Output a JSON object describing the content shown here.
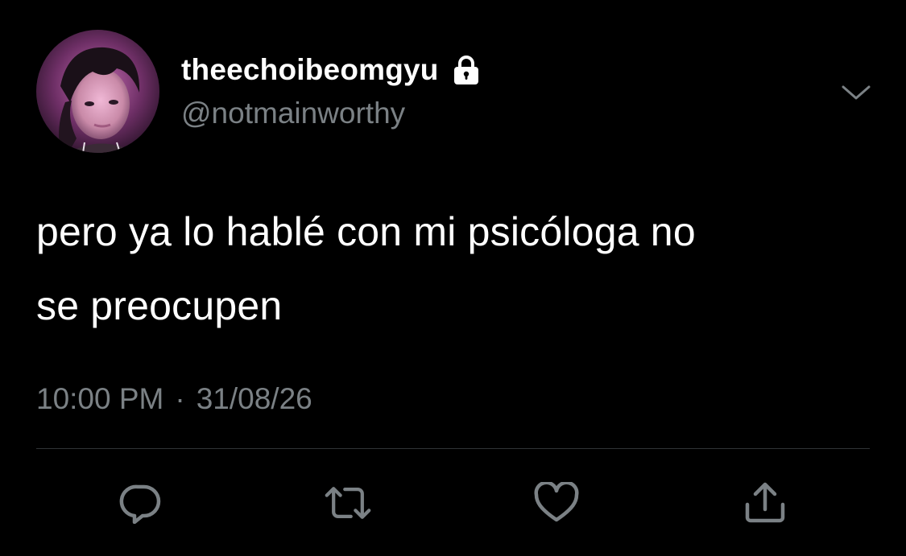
{
  "user": {
    "display_name": "theechoibeomgyu",
    "handle": "@notmainworthy",
    "protected_icon": "lock-icon"
  },
  "tweet": {
    "text_line_1": "pero ya lo hablé con mi psicóloga no",
    "text_line_2": "se preocupen",
    "time": "10:00 PM",
    "separator": "·",
    "date": "31/08/26"
  },
  "actions": {
    "icons": [
      "reply-icon",
      "retweet-icon",
      "like-icon",
      "share-icon"
    ]
  },
  "colors": {
    "background": "#000000",
    "primary_text": "#ffffff",
    "secondary_text": "#7b8185",
    "divider": "#2f3336",
    "icon": "#7b8185"
  }
}
